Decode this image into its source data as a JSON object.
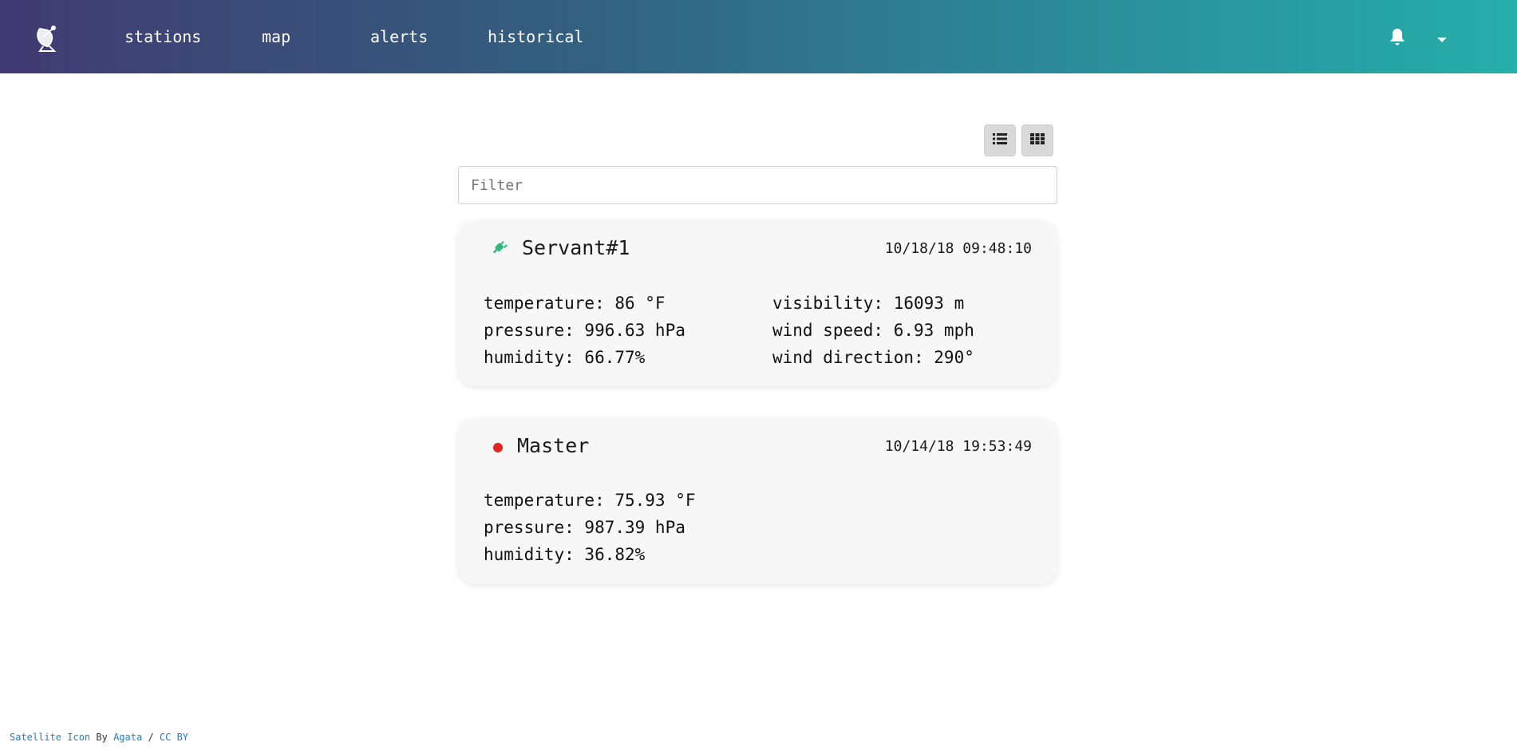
{
  "nav": {
    "logo_icon": "satellite-dish-icon",
    "links": [
      "stations",
      "map",
      "alerts",
      "historical"
    ],
    "bell_icon": "bell-icon",
    "menu_icon": "caret-down-icon",
    "gradient": [
      "#413a72",
      "#25aeaa"
    ]
  },
  "toolbar": {
    "list_view_icon": "list-icon",
    "grid_view_icon": "grid-icon"
  },
  "filter": {
    "placeholder": "Filter",
    "value": ""
  },
  "stations": [
    {
      "name": "Servant#1",
      "timestamp": "10/18/18 09:48:10",
      "status_icon": "plug-icon",
      "status_color": "#2fb87a",
      "metrics_left": [
        "temperature: 86 °F",
        "pressure: 996.63 hPa",
        "humidity: 66.77%"
      ],
      "metrics_right": [
        "visibility: 16093 m",
        "wind speed: 6.93 mph",
        "wind direction: 290°"
      ]
    },
    {
      "name": "Master",
      "timestamp": "10/14/18 19:53:49",
      "status_icon": "red-dot-icon",
      "status_color": "#e02424",
      "metrics_left": [
        "temperature: 75.93 °F",
        "pressure: 987.39 hPa",
        "humidity: 36.82%"
      ],
      "metrics_right": []
    }
  ],
  "footer": {
    "link1": "Satellite Icon",
    "by": "By",
    "link2": "Agata",
    "sep": "/",
    "link3": "CC BY"
  }
}
